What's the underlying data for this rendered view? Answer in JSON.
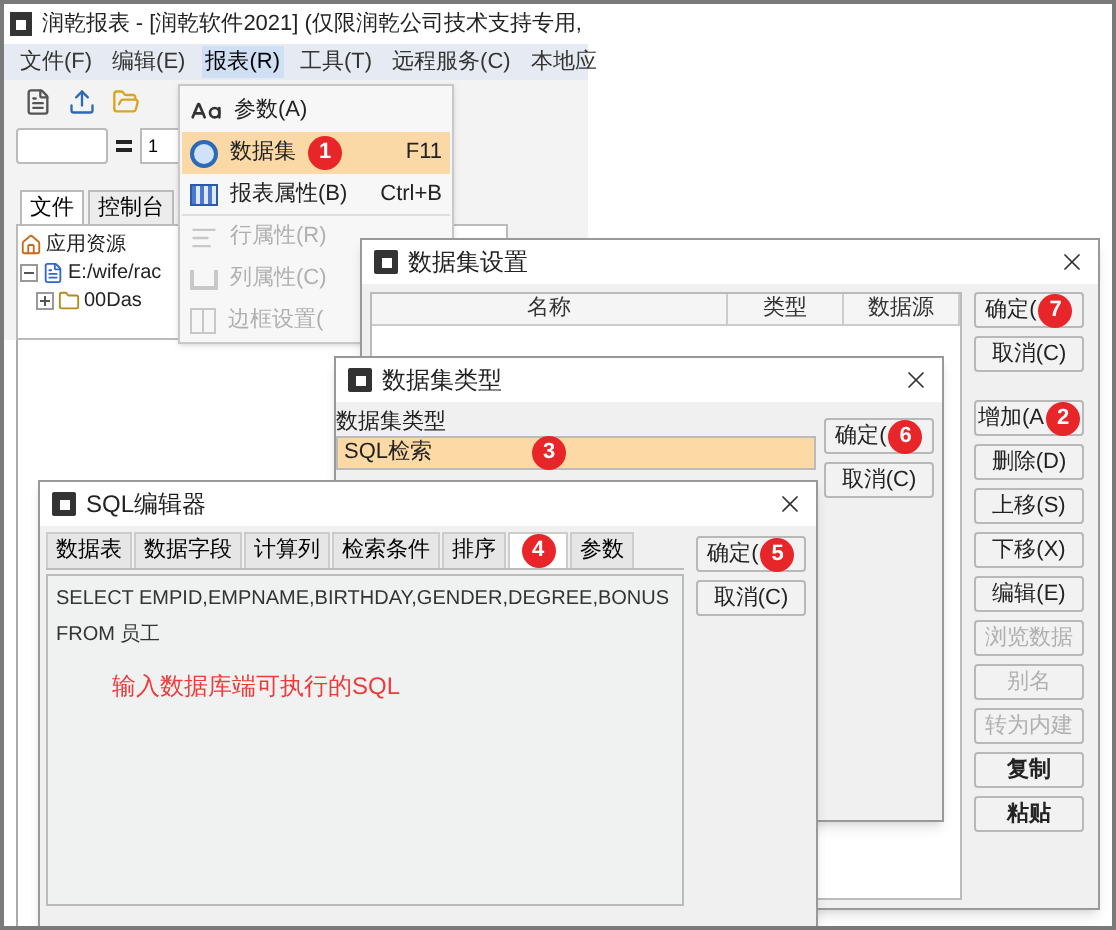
{
  "app": {
    "title": "润乾报表 - [润乾软件2021] (仅限润乾公司技术支持专用,",
    "menu": [
      {
        "label": "文件(F)",
        "selected": false
      },
      {
        "label": "编辑(E)",
        "selected": false
      },
      {
        "label": "报表(R)",
        "selected": true
      },
      {
        "label": "工具(T)",
        "selected": false
      },
      {
        "label": "远程服务(C)",
        "selected": false
      },
      {
        "label": "本地应",
        "selected": false
      }
    ],
    "formula_value": "1",
    "tabs": [
      {
        "label": "文件",
        "selected": true
      },
      {
        "label": "控制台",
        "selected": false
      }
    ],
    "tree": [
      {
        "label": "应用资源",
        "kind": "home",
        "expanded": true,
        "children": [
          {
            "label": "E:/wife/rac",
            "kind": "project",
            "expanded": true,
            "children": [
              {
                "label": "00Das",
                "kind": "folder",
                "expanded": false
              }
            ]
          }
        ]
      }
    ]
  },
  "report_menu": {
    "items": [
      {
        "label": "参数(A)",
        "kind": "param",
        "disabled": false,
        "selected": false
      },
      {
        "label": "数据集",
        "shortcut": "F11",
        "badge": "1",
        "kind": "dataset",
        "disabled": false,
        "selected": true
      },
      {
        "label": "报表属性(B)",
        "shortcut": "Ctrl+B",
        "kind": "grid",
        "disabled": false,
        "selected": false
      },
      {
        "label": "行属性(R)",
        "kind": "row",
        "disabled": true,
        "selected": false
      },
      {
        "label": "列属性(C)",
        "kind": "col",
        "disabled": true,
        "selected": false
      },
      {
        "label": "边框设置(",
        "kind": "border",
        "disabled": true,
        "selected": false
      }
    ]
  },
  "dataset_settings": {
    "title": "数据集设置",
    "columns": [
      "名称",
      "类型",
      "数据源"
    ],
    "buttons": [
      {
        "label": "确定(",
        "badge": "7",
        "disabled": false,
        "bold": false
      },
      {
        "label": "取消(C)",
        "disabled": false,
        "bold": false
      },
      {
        "label": "增加(A",
        "badge": "2",
        "disabled": false,
        "bold": false
      },
      {
        "label": "删除(D)",
        "disabled": false,
        "bold": false
      },
      {
        "label": "上移(S)",
        "disabled": false,
        "bold": false
      },
      {
        "label": "下移(X)",
        "disabled": false,
        "bold": false
      },
      {
        "label": "编辑(E)",
        "disabled": false,
        "bold": false
      },
      {
        "label": "浏览数据",
        "disabled": true,
        "bold": false
      },
      {
        "label": "别名",
        "disabled": true,
        "bold": false
      },
      {
        "label": "转为内建",
        "disabled": true,
        "bold": false
      },
      {
        "label": "复制",
        "disabled": false,
        "bold": true
      },
      {
        "label": "粘贴",
        "disabled": false,
        "bold": true
      }
    ]
  },
  "dataset_type": {
    "title": "数据集类型",
    "list_label": "数据集类型",
    "items": [
      {
        "label": "SQL检索",
        "badge": "3",
        "selected": true
      }
    ],
    "buttons": [
      {
        "label": "确定(",
        "badge": "6",
        "disabled": false,
        "bold": false
      },
      {
        "label": "取消(C)",
        "disabled": false,
        "bold": false
      }
    ]
  },
  "sql_editor": {
    "title": "SQL编辑器",
    "tabs": [
      {
        "label": "数据表",
        "selected": false
      },
      {
        "label": "数据字段",
        "selected": false
      },
      {
        "label": "计算列",
        "selected": false
      },
      {
        "label": "检索条件",
        "selected": false
      },
      {
        "label": "排序",
        "selected": false
      },
      {
        "badge": "4",
        "selected": true
      },
      {
        "label": "参数",
        "selected": false
      }
    ],
    "sql_lines": [
      "SELECT EMPID,EMPNAME,BIRTHDAY,GENDER,DEGREE,BONUS",
      "FROM 员工"
    ],
    "note": "输入数据库端可执行的SQL",
    "buttons": [
      {
        "label": "确定(",
        "badge": "5",
        "disabled": false,
        "bold": false
      },
      {
        "label": "取消(C)",
        "disabled": false,
        "bold": false
      }
    ]
  }
}
